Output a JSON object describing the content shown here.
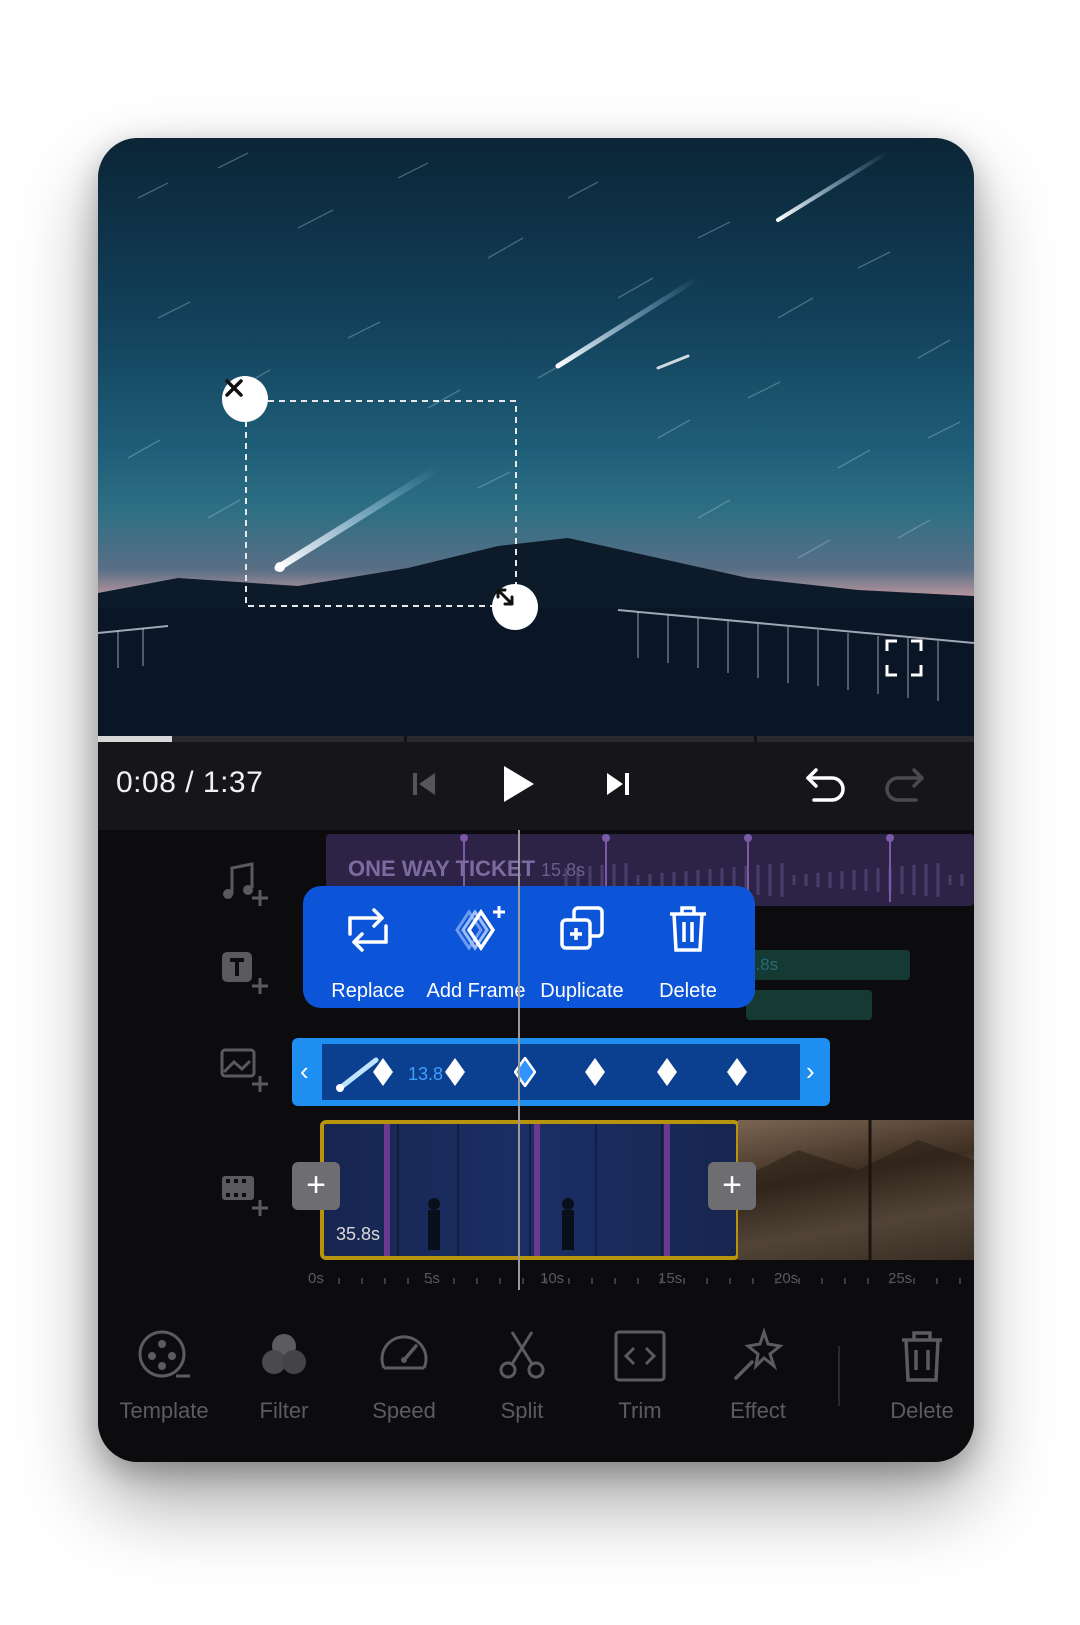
{
  "player": {
    "current_time": "0:08",
    "separator": " / ",
    "total_time": "1:37",
    "progress": 0.085
  },
  "music_track": {
    "title": "ONE WAY TICKET",
    "length": "15.8s"
  },
  "text_track": {
    "length": "5.8s"
  },
  "popup_menu": {
    "items": [
      {
        "label": "Replace",
        "icon": "replace-icon"
      },
      {
        "label": "Add Frame",
        "icon": "add-frame-icon"
      },
      {
        "label": "Duplicate",
        "icon": "duplicate-icon"
      },
      {
        "label": "Delete",
        "icon": "trash-icon"
      }
    ]
  },
  "sticker_clip": {
    "length": "13.8",
    "left_handle": "‹",
    "right_handle": "›"
  },
  "video_clip": {
    "length": "35.8s"
  },
  "ruler": {
    "ticks": [
      "0s",
      "5s",
      "10s",
      "15s",
      "20s",
      "25s"
    ]
  },
  "toolbar": {
    "items": [
      {
        "label": "Template",
        "icon": "template-icon"
      },
      {
        "label": "Filter",
        "icon": "filter-icon"
      },
      {
        "label": "Speed",
        "icon": "speed-icon"
      },
      {
        "label": "Split",
        "icon": "scissors-icon"
      },
      {
        "label": "Trim",
        "icon": "trim-icon"
      },
      {
        "label": "Effect",
        "icon": "effect-icon"
      },
      {
        "label": "Delete",
        "icon": "trash-icon"
      }
    ]
  },
  "colors": {
    "popup": "#0d55d8",
    "sticker_track": "#1e8ff0",
    "video_border": "#b8940e",
    "music_track": "#2c2346"
  }
}
